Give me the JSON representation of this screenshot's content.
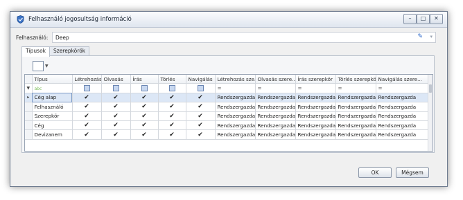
{
  "window": {
    "title": "Felhasználó jogosultság információ",
    "controls": [
      "minimize-icon",
      "maximize-icon",
      "close-icon"
    ]
  },
  "user": {
    "label": "Felhasználó:",
    "value": "Deep"
  },
  "tabs": [
    {
      "label": "Típusok",
      "active": true
    },
    {
      "label": "Szerepkörök",
      "active": false
    }
  ],
  "grid": {
    "columns": [
      "Típus",
      "Létrehozás",
      "Olvasás",
      "Írás",
      "Törlés",
      "Navigálás",
      "Létrehozás sze...",
      "Olvasás szere...",
      "Írás szerepkör",
      "Törlés szerepkör",
      "Navigálás szere..."
    ],
    "filter_text": "abc",
    "filter_eq": "=",
    "rows": [
      {
        "type": "Cég alap",
        "values": [
          "Rendszergazda",
          "Rendszergazda",
          "Rendszergazda",
          "Rendszergazda",
          "Rendszergazda"
        ]
      },
      {
        "type": "Felhasználó",
        "values": [
          "Rendszergazda",
          "Rendszergazda",
          "Rendszergazda",
          "Rendszergazda",
          "Rendszergazda"
        ]
      },
      {
        "type": "Szerepkör",
        "values": [
          "Rendszergazda",
          "Rendszergazda",
          "Rendszergazda",
          "Rendszergazda",
          "Rendszergazda"
        ]
      },
      {
        "type": "Cég",
        "values": [
          "Rendszergazda",
          "Rendszergazda",
          "Rendszergazda",
          "Rendszergazda",
          "Rendszergazda"
        ]
      },
      {
        "type": "Devizanem",
        "values": [
          "Rendszergazda",
          "Rendszergazda",
          "Rendszergazda",
          "Rendszergazda",
          "Rendszergazda"
        ]
      }
    ]
  },
  "buttons": {
    "ok": "OK",
    "cancel": "Mégsem"
  }
}
